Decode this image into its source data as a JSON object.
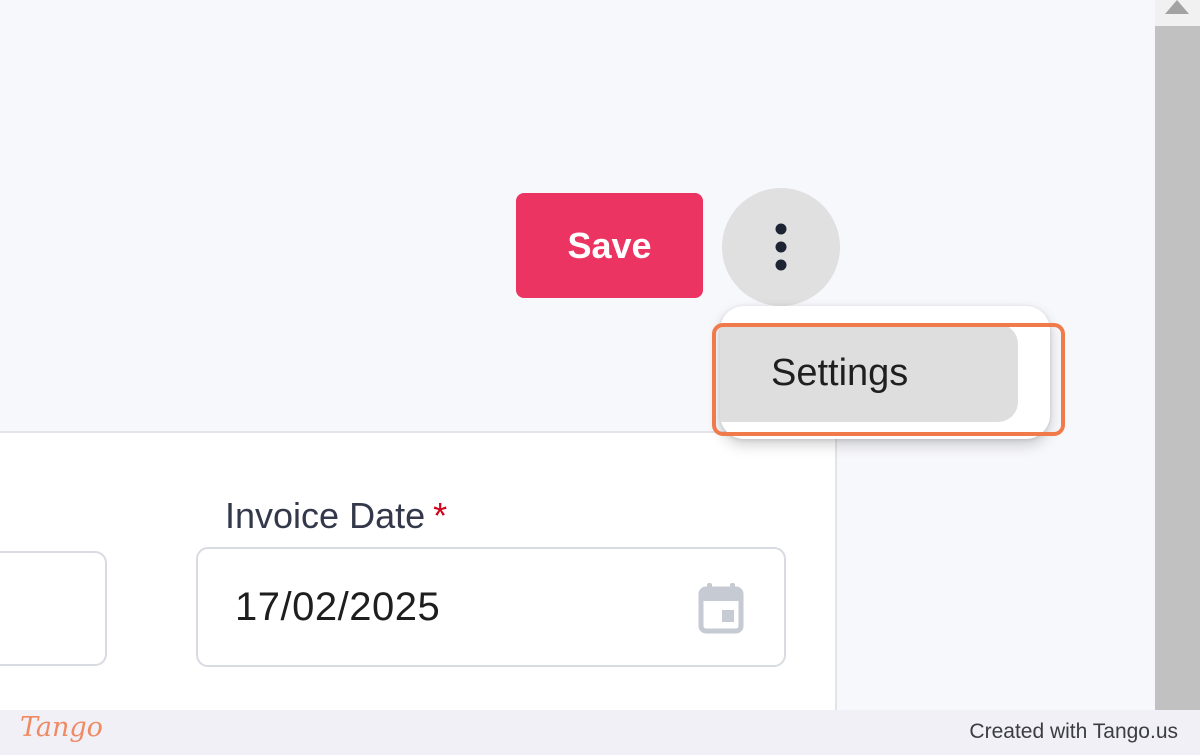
{
  "toolbar": {
    "save_label": "Save",
    "more_icon": "more-vertical-icon"
  },
  "menu": {
    "items": [
      {
        "label": "Settings"
      }
    ]
  },
  "form": {
    "invoice_date": {
      "label": "Invoice Date",
      "required_marker": "*",
      "value": "17/02/2025",
      "icon": "calendar-icon"
    }
  },
  "footer": {
    "logo": "Tango",
    "credit": "Created with Tango.us"
  },
  "colors": {
    "save_button": "#ec3463",
    "highlight": "#f07a4a",
    "required": "#d0021b",
    "background": "#f7f8fc"
  }
}
